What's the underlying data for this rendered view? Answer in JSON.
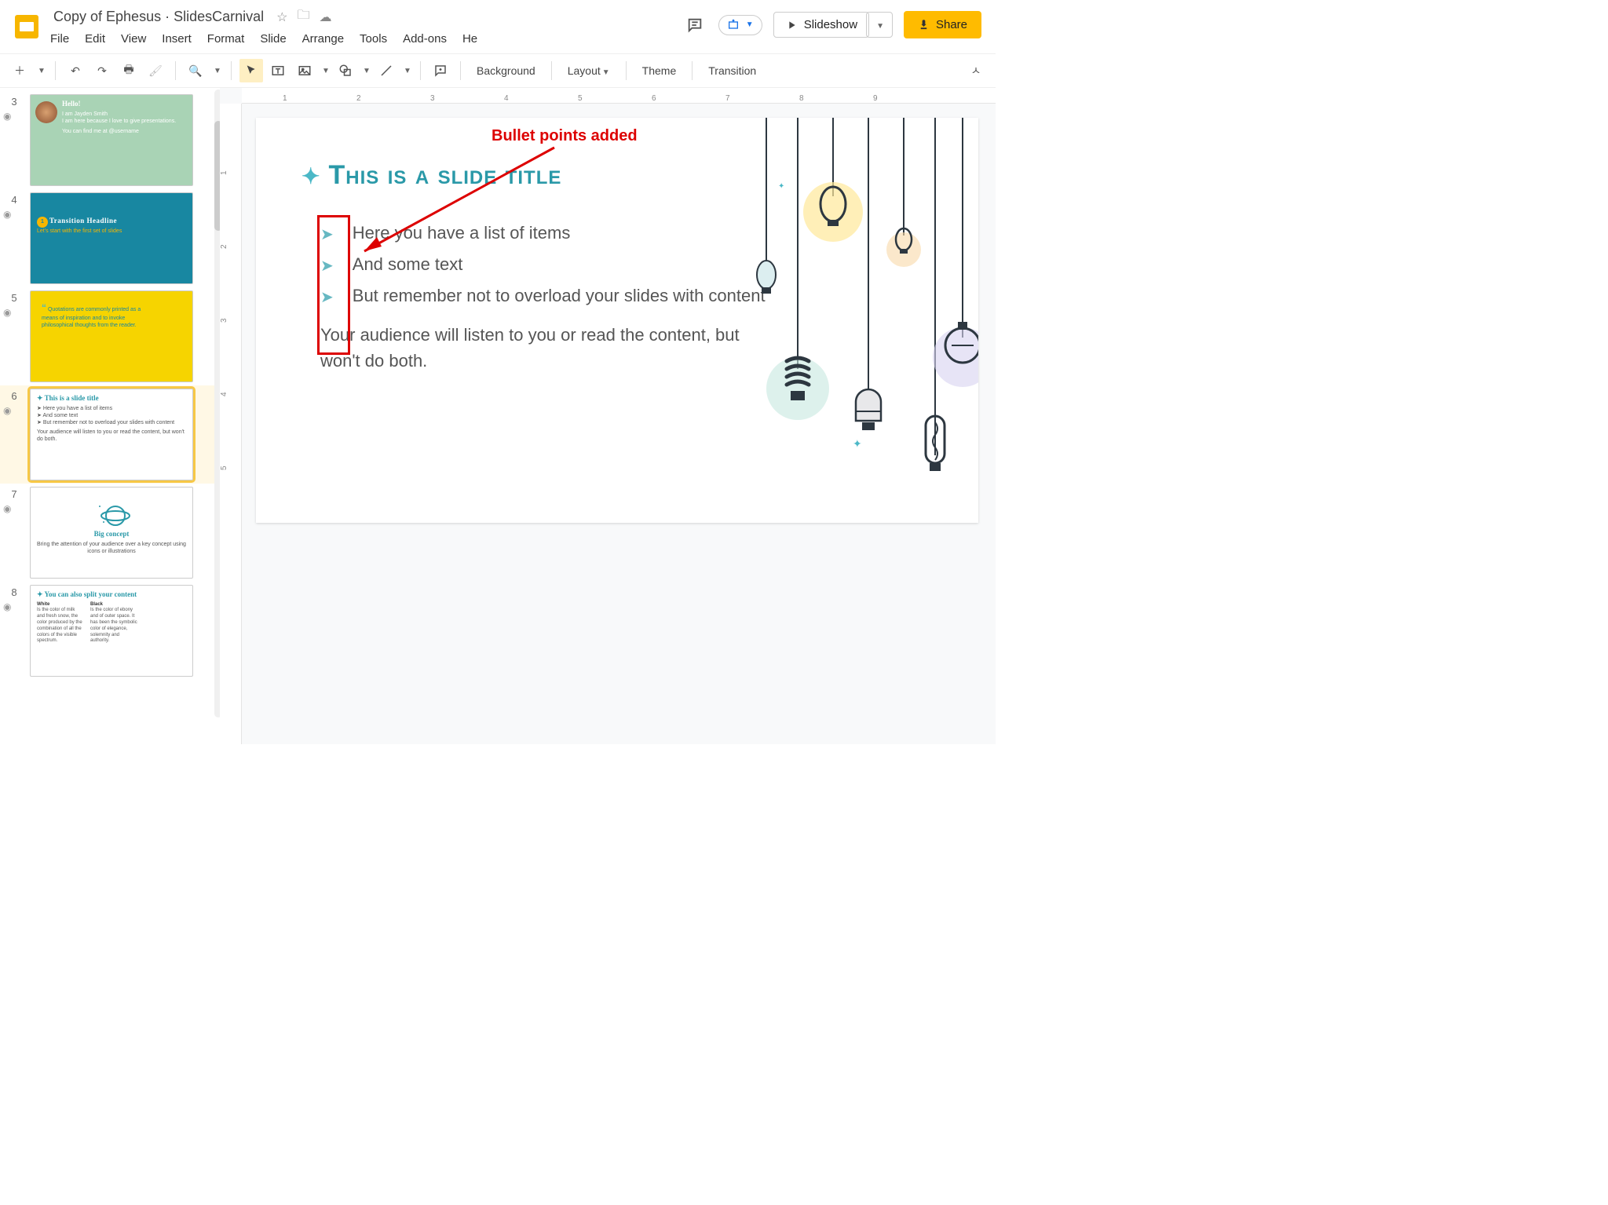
{
  "header": {
    "title": "Copy of Ephesus · SlidesCarnival",
    "menu": [
      "File",
      "Edit",
      "View",
      "Insert",
      "Format",
      "Slide",
      "Arrange",
      "Tools",
      "Add-ons",
      "He"
    ],
    "slideshow": "Slideshow",
    "share": "Share"
  },
  "toolbar": {
    "background": "Background",
    "layout": "Layout",
    "theme": "Theme",
    "transition": "Transition"
  },
  "ruler_h": [
    "1",
    "2",
    "3",
    "4",
    "5",
    "6",
    "7",
    "8",
    "9"
  ],
  "ruler_v": [
    "1",
    "2",
    "3",
    "4",
    "5"
  ],
  "thumbnails": [
    {
      "num": "3",
      "title": "Hello!",
      "sub1": "I am Jayden Smith",
      "sub2": "I am here because I love to give presentations.",
      "sub3": "You can find me at @username"
    },
    {
      "num": "4",
      "title": "Transition Headline",
      "sub": "Let's start with the first set of slides",
      "badge": "1"
    },
    {
      "num": "5",
      "quote": "Quotations are commonly printed as a means of inspiration and to invoke philosophical thoughts from the reader."
    },
    {
      "num": "6",
      "title": "This is a slide title",
      "b1": "Here you have a list of items",
      "b2": "And some text",
      "b3": "But remember not to overload your slides with content",
      "para": "Your audience will listen to you or read the content, but won't do both."
    },
    {
      "num": "7",
      "title": "Big concept",
      "sub": "Bring the attention of your audience over a key concept using icons or illustrations"
    },
    {
      "num": "8",
      "title": "You can also split your content",
      "c1t": "White",
      "c1": "Is the color of milk and fresh snow, the color produced by the combination of all the colors of the visible spectrum.",
      "c2t": "Black",
      "c2": "Is the color of ebony and of outer space. It has been the symbolic color of elegance, solemnity and authority."
    }
  ],
  "slide": {
    "title": "This is a slide title",
    "bullets": [
      "Here you have a list of items",
      "And some text",
      "But remember not to overload your slides with content"
    ],
    "para": "Your audience will listen to you or read the content, but won't do both."
  },
  "annotation": {
    "label": "Bullet points added"
  }
}
